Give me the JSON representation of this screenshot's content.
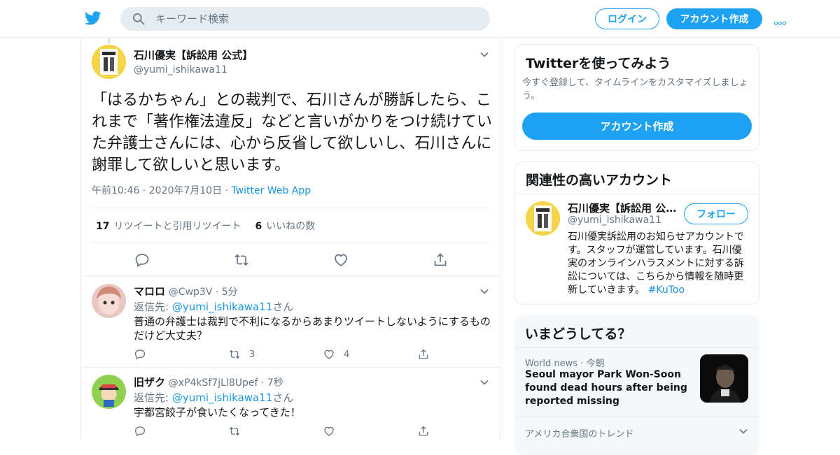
{
  "header": {
    "search_placeholder": "キーワード検索",
    "login_label": "ログイン",
    "signup_label": "アカウント作成"
  },
  "tweet": {
    "name": "石川優実【訴訟用 公式】",
    "handle": "@yumi_ishikawa11",
    "text": "「はるかちゃん」との裁判で、石川さんが勝訴したら、これまで「著作権法違反」などと言いがかりをつけ続けていた弁護士さんには、心から反省して欲しいし、石川さんに謝罪して欲しいと思います。",
    "time": "午前10:46",
    "date": "2020年7月10日",
    "app": "Twitter Web App",
    "retweets": "17",
    "retweets_label": "リツイートと引用リツイート",
    "likes": "6",
    "likes_label": "いいねの数"
  },
  "replies": [
    {
      "name": "マロロ",
      "handle": "@Cwp3V",
      "age": "5分",
      "reply_prefix": "返信先: ",
      "reply_to": "@yumi_ishikawa11",
      "reply_suffix": "さん",
      "text": "普通の弁護士は裁判で不利になるからあまりツイートしないようにするものだけど大丈夫？",
      "retweets": "3",
      "likes": "4"
    },
    {
      "name": "旧ザク",
      "handle": "@xP4kSf7jLl8Upef",
      "age": "7秒",
      "reply_prefix": "返信先: ",
      "reply_to": "@yumi_ishikawa11",
      "reply_suffix": "さん",
      "text": "宇都宮餃子が食いたくなってきた！",
      "retweets": "",
      "likes": ""
    }
  ],
  "sidebar": {
    "signup": {
      "title": "Twitterを使ってみよう",
      "desc": "今すぐ登録して、タイムラインをカスタマイズしましょう。",
      "button": "アカウント作成"
    },
    "related": {
      "title": "関連性の高いアカウント",
      "name": "石川優実【訴訟用 公式】",
      "handle": "@yumi_ishikawa11",
      "follow": "フォロー",
      "bio": "石川優実訴訟用のお知らせアカウントです。スタッフが運営しています。石川優実のオンラインハラスメントに対する訴訟については、こちらから情報を随時更新していきます。",
      "hashtag": "#KuToo"
    },
    "trends": {
      "title": "いまどうしてる？",
      "category": "World news",
      "time": "今朝",
      "headline": "Seoul mayor Park Won-Soon found dead hours after being reported missing",
      "location": "アメリカ合衆国のトレンド"
    }
  },
  "colors": {
    "brand": "#1da1f2",
    "link": "#1b95e0",
    "muted": "#657786",
    "border": "#e6ecf0"
  }
}
